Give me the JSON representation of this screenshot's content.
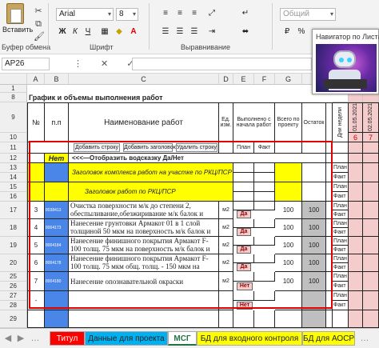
{
  "ribbon": {
    "paste_label": "Вставить",
    "clipboard_group": "Буфер обмена",
    "font_name": "Arial",
    "font_size": "8",
    "font_group": "Шрифт",
    "align_group": "Выравнивание",
    "number_format": "Общий",
    "bold": "Ж",
    "italic": "К",
    "underline": "Ч"
  },
  "formula_bar": {
    "name_box": "AP26",
    "buttons": "⋮ ✕ ✓ fx",
    "formula_value": ""
  },
  "navigator": {
    "title": "Навигатор по Листам"
  },
  "columns": [
    "A",
    "B",
    "C",
    "D",
    "E",
    "F",
    "G",
    "H",
    "I",
    "AL",
    "AM",
    "AN"
  ],
  "rows": [
    "1",
    "8",
    "9",
    "10",
    "11",
    "12",
    "13",
    "14",
    "15",
    "16",
    "17",
    "18",
    "19",
    "20",
    "21",
    "22",
    "23",
    "24",
    "25",
    "26",
    "27",
    "28",
    "29"
  ],
  "sheet": {
    "title": "График и объемы выполнения работ",
    "hdr_no": "№",
    "hdr_pp": "п.п",
    "hdr_name": "Наименование работ",
    "hdr_unit": "Ед. изм.",
    "hdr_done": "Выполнено с начала работ",
    "hdr_total": "Всего по проекту",
    "hdr_rest": "Остаток",
    "hdr_days": "Дни недели",
    "date1": "01.05.2021",
    "date2": "02.05.2021",
    "day1": "6",
    "day2": "7",
    "btn_add_row": "Добавить строку",
    "btn_add_header": "Добавить заголовок",
    "btn_del_row": "Удалить строку",
    "plan": "План",
    "fact": "Факт",
    "toggle_value": "Нет",
    "toggle_hint": "<<<—Отобразить водсказку Да/Нет",
    "header_row1": "Заголовок комплекса работ на участке по РКЦ/ПСР",
    "header_row2": "Заголовок работ по РКЦ/ПСР",
    "items": [
      {
        "n": "3",
        "code": "8038413",
        "name": "Очистка поверхности м/к до степени 2, обеспыливание,обезжиривание м/к балок и",
        "unit": "м2",
        "chip": "Да",
        "total": "100",
        "rest": "100"
      },
      {
        "n": "4",
        "code": "8004173",
        "name": "Нанесение грунтовки Армакот 01 в 1 слой толщиной 50 мкм на поверхность м/к балок и",
        "unit": "м2",
        "chip": "Да",
        "total": "100",
        "rest": "100"
      },
      {
        "n": "5",
        "code": "8004184",
        "name": "Нанесение финишного покрытия Армакот F-100 толщ. 75 мкм на поверхность м/к балок и",
        "unit": "м2",
        "chip": "Да",
        "total": "100",
        "rest": "100"
      },
      {
        "n": "6",
        "code": "8004178",
        "name": "Нанесение финишного покрытия Армакот F-100 толщ. 75 мкм общ. толщ. - 150 мкм на",
        "unit": "м2",
        "chip": "Да",
        "total": "100",
        "rest": "100"
      },
      {
        "n": "7",
        "code": "8004180",
        "name": "Нанесение опознавательной окраски",
        "unit": "м2",
        "chip": "Нет",
        "total": "100",
        "rest": "100"
      }
    ],
    "dash": "-"
  },
  "tabs": [
    {
      "label": "Титул",
      "color": "#ff0000"
    },
    {
      "label": "Данные для проекта",
      "color": "#00b0f0"
    },
    {
      "label": "МСГ",
      "color": "#ffffff"
    },
    {
      "label": "БД для входного контроля",
      "color": "#ffff00"
    },
    {
      "label": "БД для АОСР",
      "color": "#ffff00"
    }
  ]
}
